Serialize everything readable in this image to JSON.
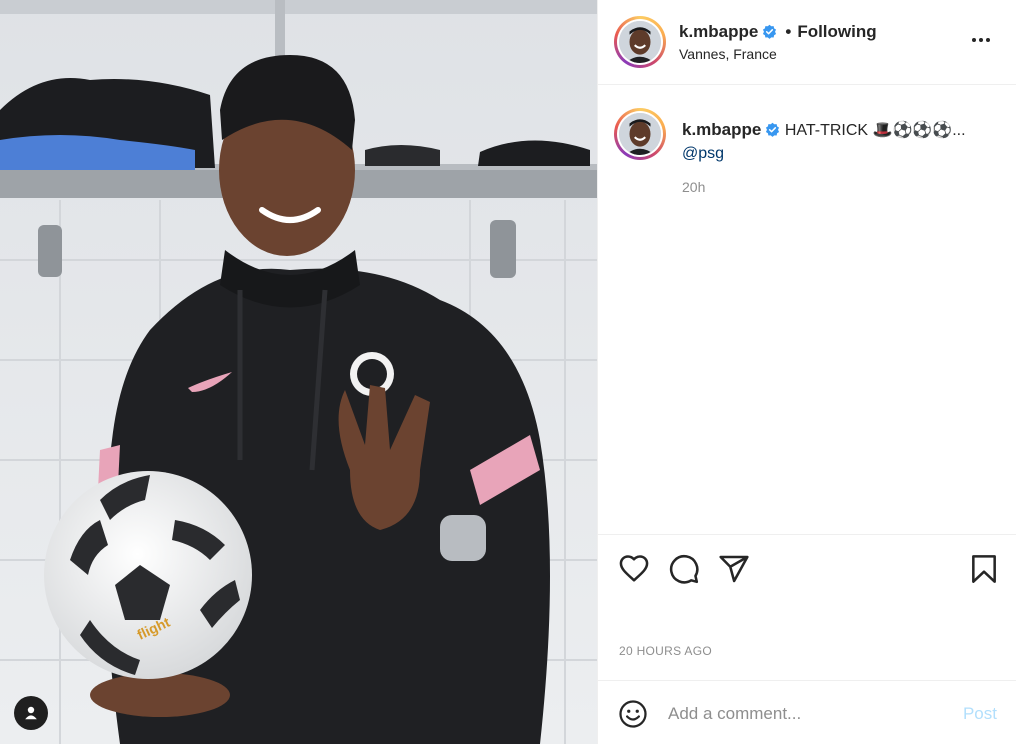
{
  "post": {
    "username": "k.mbappe",
    "separator": "•",
    "follow_status": "Following",
    "location": "Vannes, France",
    "caption_text": "HAT-TRICK 🎩⚽⚽⚽...",
    "caption_mention": "@psg",
    "caption_time": "20h",
    "posted_time": "20 HOURS AGO"
  },
  "comment": {
    "placeholder": "Add a comment...",
    "post_label": "Post"
  },
  "icons": {
    "header_more": "more-options-icon",
    "verified": "verified-badge-icon",
    "like": "heart-icon",
    "comment": "comment-icon",
    "share": "paper-plane-icon",
    "save": "bookmark-icon",
    "emoji": "emoji-icon",
    "tag": "user-tag-icon"
  },
  "colors": {
    "verified": "#3897f0",
    "mention": "#00376b",
    "post_disabled": "#b2dffc",
    "muted": "#8e8e8e"
  }
}
